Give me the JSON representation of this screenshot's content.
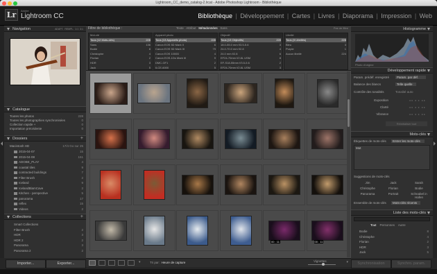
{
  "window": {
    "title": "Lightroom_CC_demo_catalog-2.lrcat - Adobe Photoshop Lightroom - Bibliothèque"
  },
  "identity": {
    "logo": "Lr",
    "brand": "Adobe",
    "product": "Lightroom CC"
  },
  "modules": [
    "Bibliothèque",
    "Développement",
    "Cartes",
    "Livres",
    "Diaporama",
    "Impression",
    "Web"
  ],
  "active_module": "Bibliothèque",
  "left": {
    "navigator": {
      "title": "Navigation",
      "zoom_options": [
        "ADAPT.",
        "REMPL.",
        "1:1",
        "3:1"
      ]
    },
    "catalog": {
      "title": "Catalogue",
      "items": [
        {
          "label": "Toutes les photos",
          "count": "228"
        },
        {
          "label": "Toutes les photographies synchronisées",
          "count": "0"
        },
        {
          "label": "Collection rapide +",
          "count": "0"
        },
        {
          "label": "Importation précédente",
          "count": "0"
        }
      ]
    },
    "folders": {
      "title": "Dossiers",
      "volume": "Macintosh HD",
      "volume_info": "17/4 Go sur 25",
      "items": [
        {
          "label": "2015-04-07",
          "count": "15"
        },
        {
          "label": "2015-04-08",
          "count": "151"
        },
        {
          "label": "ADOBE_PLAY",
          "count": "4"
        },
        {
          "label": "coastal tiles",
          "count": "9"
        },
        {
          "label": "contracted buildings",
          "count": "7"
        },
        {
          "label": "Filter Brush",
          "count": "2"
        },
        {
          "label": "Iceland",
          "count": "9"
        },
        {
          "label": "IcelandBlamCave",
          "count": "2"
        },
        {
          "label": "Kitchen - perspective",
          "count": "5"
        },
        {
          "label": "panorama",
          "count": "17"
        },
        {
          "label": "reflex",
          "count": "15"
        },
        {
          "label": "Videos",
          "count": "2"
        }
      ]
    },
    "collections": {
      "title": "Collections",
      "items": [
        {
          "label": "Smart Collections",
          "count": ""
        },
        {
          "label": "Filter Brush",
          "count": "2"
        },
        {
          "label": "HDR",
          "count": "3"
        },
        {
          "label": "HDR 2",
          "count": "2"
        },
        {
          "label": "Panorama",
          "count": "3"
        },
        {
          "label": "Panorama 2",
          "count": "2"
        }
      ]
    },
    "import_button": "Importer...",
    "export_button": "Exporter..."
  },
  "filter": {
    "title": "Filtre de bibliothèque :",
    "tabs": [
      "Texte",
      "Attribut",
      "Métadonnées",
      "Sans"
    ],
    "active_tab": "Métadonnées",
    "preset": "Pas de filtre",
    "columns": [
      {
        "header": "Mot-clé",
        "rows": [
          {
            "label": "Tous (12 Mots-clés)",
            "count": "228",
            "selected": true
          },
          {
            "label": "Sans",
            "count": "136",
            "selected": false
          },
          {
            "label": "Bodie",
            "count": "8",
            "selected": false
          },
          {
            "label": "Christophe",
            "count": "4",
            "selected": false
          },
          {
            "label": "Florian",
            "count": "2",
            "selected": false
          },
          {
            "label": "HDR",
            "count": "3",
            "selected": false
          },
          {
            "label": "Jack",
            "count": "5",
            "selected": false
          }
        ]
      },
      {
        "header": "Appareil photo",
        "rows": [
          {
            "label": "Tous (13 Appareils photo)",
            "count": "228",
            "selected": true
          },
          {
            "label": "Canon EOS 5D Mark II",
            "count": "6",
            "selected": false
          },
          {
            "label": "Canon EOS 5D Mark III",
            "count": "79",
            "selected": false
          },
          {
            "label": "Canon EOS 1000D",
            "count": "4",
            "selected": false
          },
          {
            "label": "Canon EOS-1Ds Mark III",
            "count": "9",
            "selected": false
          },
          {
            "label": "DMC-GF1",
            "count": "2",
            "selected": false
          },
          {
            "label": "ILCE-6000",
            "count": "5",
            "selected": false
          }
        ]
      },
      {
        "header": "Objectif",
        "rows": [
          {
            "label": "Tous (13 Objectifs)",
            "count": "228",
            "selected": true
          },
          {
            "label": "18.0-55.0 mm f/3.5-5.6",
            "count": "3",
            "selected": false
          },
          {
            "label": "24.0-70.0 mm f/2.8",
            "count": "4",
            "selected": false
          },
          {
            "label": "24.0 mm f/2.8",
            "count": "6",
            "selected": false
          },
          {
            "label": "EF24-70mm f/2.8L USM",
            "count": "8",
            "selected": false
          },
          {
            "label": "EF-S18-55mm f/3.5-5.6",
            "count": "2",
            "selected": false
          },
          {
            "label": "EF24-70mm f/2.8L USM",
            "count": "3",
            "selected": false
          }
        ]
      },
      {
        "header": "Libellé",
        "rows": [
          {
            "label": "Tous (3 Libellés)",
            "count": "228",
            "selected": true
          },
          {
            "label": "Bleu",
            "count": "3",
            "selected": false
          },
          {
            "label": "Purple",
            "count": "1",
            "selected": false
          },
          {
            "label": "Aucun libellé",
            "count": "224",
            "selected": false
          }
        ]
      }
    ]
  },
  "grid": {
    "thumbs": [
      {
        "c1": "#2b1d18",
        "c2": "#c9a58b",
        "w": 0.85,
        "h": 0.62
      },
      {
        "c1": "#6c7580",
        "c2": "#b9a48e",
        "w": 0.85,
        "h": 0.56
      },
      {
        "c1": "#201a14",
        "c2": "#8a6645",
        "w": 0.55,
        "h": 0.82
      },
      {
        "c1": "#2d2620",
        "c2": "#caa47c",
        "w": 0.85,
        "h": 0.55
      },
      {
        "c1": "#1e1811",
        "c2": "#c38c5a",
        "w": 0.5,
        "h": 0.82
      },
      {
        "c1": "#2a2a2a",
        "c2": "#888888",
        "w": 0.55,
        "h": 0.78
      },
      {
        "c1": "#2a1410",
        "c2": "#d6714a",
        "w": 0.82,
        "h": 0.55
      },
      {
        "c1": "#351c2e",
        "c2": "#d18a80",
        "w": 0.82,
        "h": 0.55
      },
      {
        "c1": "#181510",
        "c2": "#b08a62",
        "w": 0.82,
        "h": 0.55
      },
      {
        "c1": "#131b24",
        "c2": "#7a8c93",
        "w": 0.82,
        "h": 0.55
      },
      {
        "c1": "#1d1612",
        "c2": "#a8805d",
        "w": 0.82,
        "h": 0.55
      },
      {
        "c1": "#221c1c",
        "c2": "#9d7468",
        "w": 0.82,
        "h": 0.55
      },
      {
        "c1": "#b83020",
        "c2": "#d98b66",
        "w": 0.55,
        "h": 0.82
      },
      {
        "c1": "#c32d22",
        "c2": "#7a5b36",
        "w": 0.55,
        "h": 0.82
      },
      {
        "c1": "#16110c",
        "c2": "#a87848",
        "w": 0.82,
        "h": 0.55
      },
      {
        "c1": "#1a1410",
        "c2": "#b08660",
        "w": 0.82,
        "h": 0.55
      },
      {
        "c1": "#1c1812",
        "c2": "#ba9264",
        "w": 0.82,
        "h": 0.55
      },
      {
        "c1": "#14100c",
        "c2": "#c19b6c",
        "w": 0.82,
        "h": 0.55
      },
      {
        "c1": "#3a3a3a",
        "c2": "#c2b9a8",
        "w": 0.82,
        "h": 0.55
      },
      {
        "c1": "#6a7a8a",
        "c2": "#e6e6e6",
        "w": 0.55,
        "h": 0.82
      },
      {
        "c1": "#3c5b8c",
        "c2": "#e6ebef",
        "w": 0.55,
        "h": 0.82
      },
      {
        "c1": "#3e5d90",
        "c2": "#e0e4ea",
        "w": 0.55,
        "h": 0.82
      },
      {
        "c1": "#1a0e1c",
        "c2": "#7a2a6a",
        "w": 0.82,
        "h": 0.55
      },
      {
        "c1": "#1a0e1c",
        "c2": "#82306a",
        "w": 0.82,
        "h": 0.55
      }
    ],
    "video_labels": [
      "00 : 11",
      "00 : 11"
    ]
  },
  "toolbar": {
    "sort_label": "Tri par :",
    "sort_value": "Heure de capture",
    "thumb_label": "Vignettes"
  },
  "right": {
    "histogram": {
      "title": "Histogramme",
      "original": "Photo d'origine"
    },
    "quick_develop": {
      "title": "Développement rapide",
      "preset_label": "Param. prédéf. enregistré",
      "preset_value": "Param. par déf.",
      "wb_label": "Balance des blancs",
      "wb_value": "Telle quelle",
      "tone_label": "Contrôle des tonalités",
      "tone_value": "Tonalité auto",
      "sliders": [
        "Exposition",
        "Clarté",
        "Vibrance"
      ],
      "reset": "Réinitialiser tout"
    },
    "keywords": {
      "title": "Mots-clés",
      "tag_label": "Étiquettes de mots-clés",
      "tag_value": "Entrer les mots-clés",
      "tag_text": "Mot",
      "suggest_title": "Suggestions de mots-clés",
      "suggestions": [
        "Jim",
        "Jack",
        "Sarah",
        "Christophe",
        "Florian",
        "Bodie",
        "Panorama",
        "Portrait",
        "Schnabel in Hafen"
      ],
      "set_label": "Ensemble de mots-clés",
      "set_value": "Mots-clés récents"
    },
    "keyword_list": {
      "title": "Liste des mots-clés",
      "tabs": [
        "Tout",
        "Personnes",
        "Autre"
      ],
      "items": [
        {
          "label": "Bodie",
          "count": "8"
        },
        {
          "label": "Christophe",
          "count": "4"
        },
        {
          "label": "Florian",
          "count": "2"
        },
        {
          "label": "HDR",
          "count": "3"
        },
        {
          "label": "Jack",
          "count": "5"
        }
      ]
    },
    "sync_button": "Synchronisation",
    "sync_params_button": "Synchro. param."
  },
  "colors": {
    "accent": "#ffffff",
    "panel": "#303030",
    "grid_bg": "#4a4a4a"
  }
}
